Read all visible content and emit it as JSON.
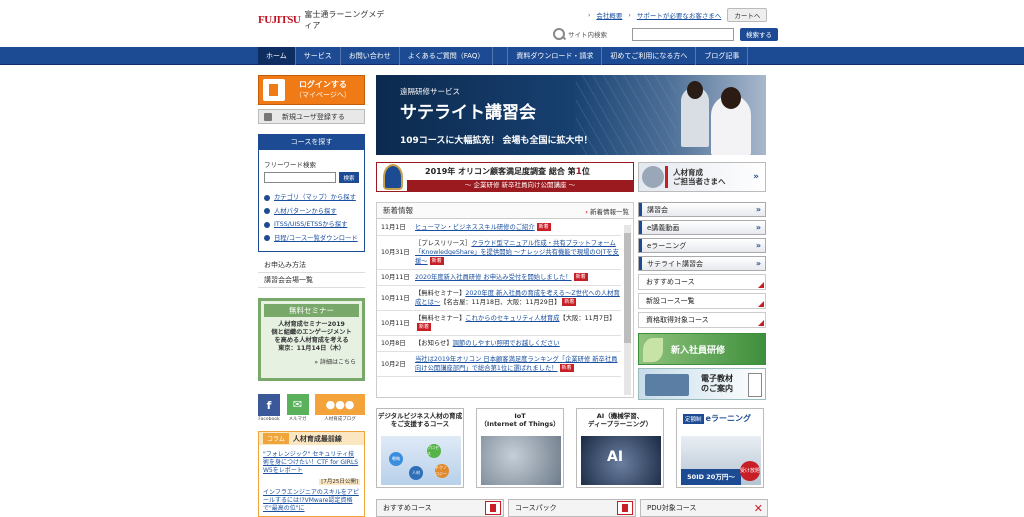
{
  "header": {
    "logo_brand": "FUJITSU",
    "logo_company": "富士通ラーニングメディア",
    "links": [
      "会社概要",
      "サポートが必要なお客さまへ"
    ],
    "cart_label": "カートへ",
    "search_label": "サイト内検索",
    "search_placeholder": "",
    "search_button": "検索する"
  },
  "nav": {
    "items": [
      "ホーム",
      "サービス",
      "お問い合わせ",
      "よくあるご質問（FAQ）",
      "資料ダウンロード・請求",
      "初めてご利用になる方へ",
      "ブログ記事"
    ]
  },
  "sidebar": {
    "login_line1": "ログインする",
    "login_line2": "（マイページへ）",
    "register_label": "新規ユーザ登録する",
    "find_title": "コースを探す",
    "freeword_label": "フリーワード検索",
    "freeword_button": "検索",
    "find_links": [
      "カテゴリ（マップ）から探す",
      "人材パターンから探す",
      "ITSS/UISS/ETSSから探す",
      "日程/コース一覧ダウンロード"
    ],
    "info_links": [
      "お申込み方法",
      "講習会会場一覧"
    ],
    "seminar": {
      "title": "無料セミナー",
      "lines": [
        "人材育成セミナー2019",
        "個と組織のエンゲージメント",
        "を高める人材育成を考える",
        "東京：11月14日（木）"
      ],
      "more": "詳細はこちら"
    },
    "social": [
      {
        "icon": "facebook-icon",
        "glyph": "f",
        "caption": "Facebook"
      },
      {
        "icon": "mail-icon",
        "glyph": "✉",
        "caption": "メルマガ"
      },
      {
        "icon": "blog-icon",
        "glyph": "●●●",
        "caption": "人材育成ブログ"
      }
    ],
    "column": {
      "tag": "コラム",
      "title": "人材育成最前線",
      "article1": "\"フォレンジック\" セキュリティ技術を身につけたい！CTF for GIRLS W5をレポート",
      "article1_date": "[7月25日公開]",
      "article2": "インフラエンジニアのスキルをアピールするには!?VMware認定資格で\"最高の位\"に"
    }
  },
  "banner": {
    "sub": "遠隔研修サービス",
    "title": "サテライト講習会",
    "tagline": "109コースに大幅拡充！ 会場も全国に拡大中！"
  },
  "award": {
    "text_prefix": "2019年 オリコン顧客満足度調査 総合 第",
    "rank": "1",
    "text_suffix": "位",
    "subline": "～ 企業研修 新卒社員向け公開講座 ～"
  },
  "corp": {
    "line1": "人材育成",
    "line2": "ご担当者さまへ",
    "arrow": "»"
  },
  "news": {
    "title": "新着情報",
    "more": "新着情報一覧",
    "items": [
      {
        "date": "11月1日",
        "prefix": "",
        "link": "ヒューマン・ビジネススキル研修のご紹介",
        "suffix": "",
        "new": true
      },
      {
        "date": "10月31日",
        "prefix": "［プレスリリース］",
        "link": "クラウド型マニュアル作成・共有プラットフォーム「KnowledgeShare」を提供開始 ～ナレッジ共有機能で現場のOJTを支援～",
        "suffix": "",
        "new": true
      },
      {
        "date": "10月11日",
        "prefix": "",
        "link": "2020年度新入社員研修 お申込み受付を開始しました！",
        "suffix": "",
        "new": true
      },
      {
        "date": "10月11日",
        "prefix": "【無料セミナー】",
        "link": "2020年度 新入社員の育成を考える～Z世代への人材育成とは～",
        "suffix": "【名古屋：11月18日、大阪：11月29日】",
        "new": true
      },
      {
        "date": "10月11日",
        "prefix": "【無料セミナー】",
        "link": "これからのセキュリティ人材育成",
        "suffix": "【大阪：11月7日】",
        "new": true
      },
      {
        "date": "10月8日",
        "prefix": "【お知らせ】",
        "link": "調節のしやすい照明でお越しください",
        "suffix": "",
        "new": false
      },
      {
        "date": "10月2日",
        "prefix": "",
        "link": "当社は2019年オリコン 日本顧客満足度ランキング「企業研修 新卒社員向け公開講座部門」で総合第1位に選ばれました！",
        "suffix": "",
        "new": true
      }
    ],
    "new_badge": "新着"
  },
  "right_buttons": [
    "講習会",
    "e講義動画",
    "eラーニング",
    "サテライト講習会"
  ],
  "right_buttons2": [
    "おすすめコース",
    "新設コース一覧",
    "資格取得対象コース"
  ],
  "promo": {
    "shinnyu": "新入社員研修",
    "denshi_line1": "電子教材",
    "denshi_line2": "のご案内"
  },
  "tiles": [
    {
      "title": "デジタルビジネス人材の育成をご支援するコース",
      "bubbles": [
        "戦略",
        "プロセス",
        "テクノロジー",
        "人材"
      ]
    },
    {
      "title": "IoT",
      "subtitle": "（Internet of Things）"
    },
    {
      "title": "AI（機械学習、",
      "subtitle": "ディープラーニング）",
      "image_text": "AI"
    },
    {
      "tag": "定額制",
      "title": "eラーニング",
      "price": "50ID 20万円～",
      "badge": "受け放題"
    }
  ],
  "bottom_bar": [
    "おすすめコース",
    "コースパック",
    "PDU対象コース"
  ],
  "colors": {
    "navy": "#1d4b93",
    "orange": "#f07a16",
    "red": "#c81e25",
    "green": "#79a86b"
  }
}
